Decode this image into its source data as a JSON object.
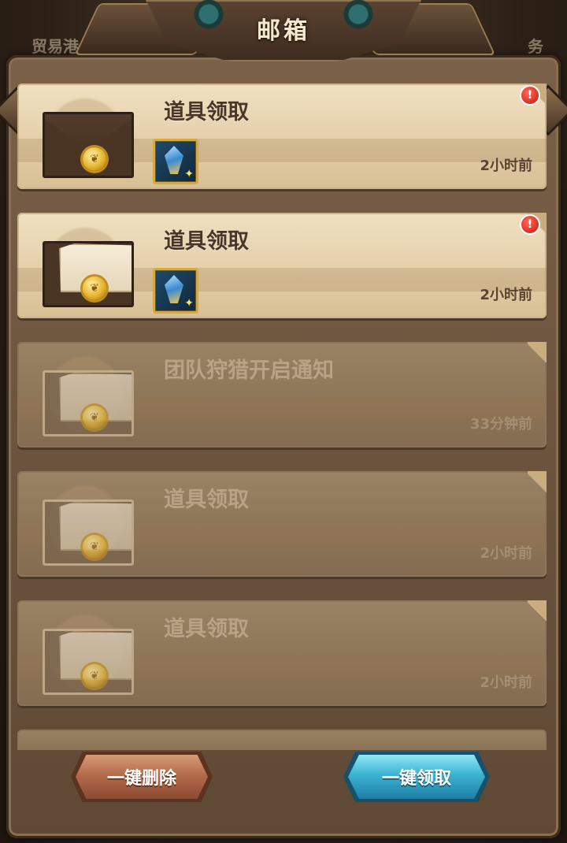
{
  "window": {
    "title": "邮箱"
  },
  "background_tabs": {
    "left_label": "贸易港",
    "right_label": "务"
  },
  "mails": [
    {
      "title": "道具领取",
      "time": "2小时前",
      "read": false,
      "has_item": true,
      "badge": "!"
    },
    {
      "title": "道具领取",
      "time": "2小时前",
      "read": false,
      "has_item": true,
      "badge": "!"
    },
    {
      "title": "团队狩猎开启通知",
      "time": "33分钟前",
      "read": true,
      "has_item": false,
      "badge": ""
    },
    {
      "title": "道具领取",
      "time": "2小时前",
      "read": true,
      "has_item": false,
      "badge": ""
    },
    {
      "title": "道具领取",
      "time": "2小时前",
      "read": true,
      "has_item": false,
      "badge": ""
    }
  ],
  "actions": {
    "delete_all": "一键删除",
    "claim_all": "一键领取"
  },
  "colors": {
    "claim_button": "#3cb3d2",
    "delete_button": "#b56c4c",
    "badge": "#c4160c"
  },
  "icons": {
    "item": "crystal-staff-icon",
    "envelope": "envelope-icon",
    "seal": "wax-seal-icon"
  }
}
